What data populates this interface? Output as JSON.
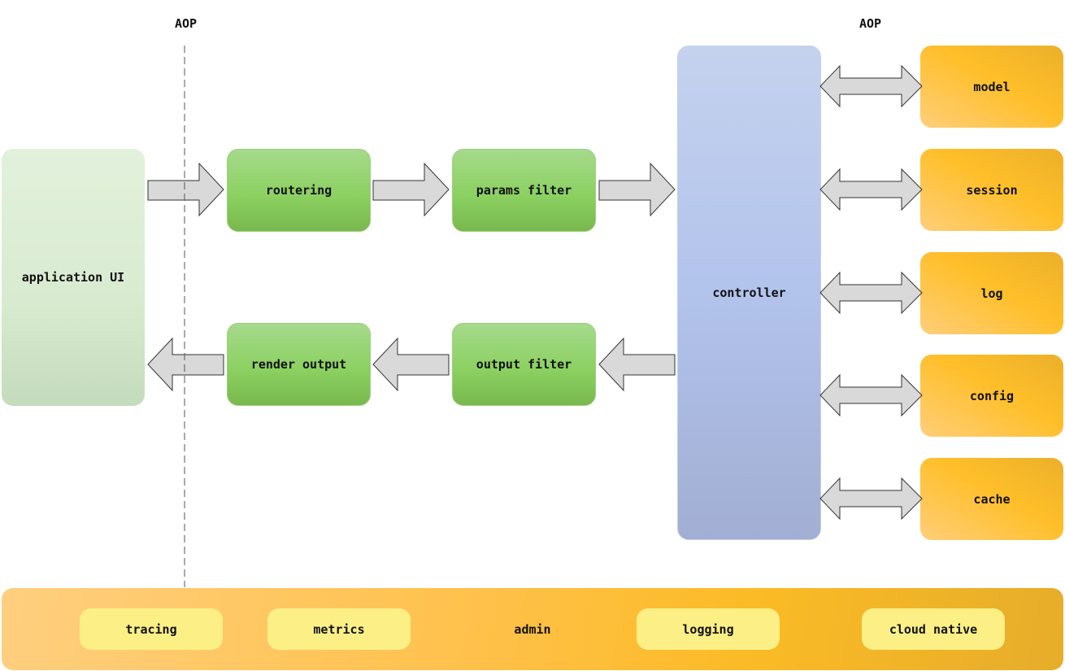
{
  "aop_labels": [
    "AOP",
    "AOP"
  ],
  "client": {
    "label": "application UI"
  },
  "pipeline": {
    "request": [
      {
        "label": "routering"
      },
      {
        "label": "params filter"
      }
    ],
    "response": [
      {
        "label": "render output"
      },
      {
        "label": "output filter"
      }
    ]
  },
  "controller": {
    "label": "controller"
  },
  "services": [
    {
      "label": "model"
    },
    {
      "label": "session"
    },
    {
      "label": "log"
    },
    {
      "label": "config"
    },
    {
      "label": "cache"
    }
  ],
  "infrastructure": {
    "items": [
      {
        "label": "tracing",
        "boxed": true
      },
      {
        "label": "metrics",
        "boxed": true
      },
      {
        "label": "admin",
        "boxed": false
      },
      {
        "label": "logging",
        "boxed": true
      },
      {
        "label": "cloud native",
        "boxed": true
      }
    ]
  },
  "colors": {
    "arrow_fill": "#d9d9d9",
    "arrow_stroke": "#333333"
  }
}
